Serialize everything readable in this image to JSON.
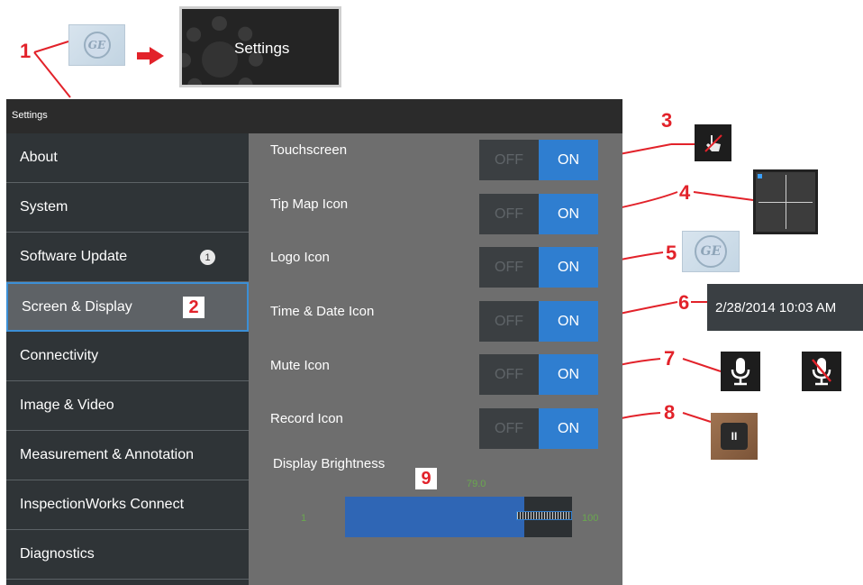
{
  "callouts": {
    "c1": "1",
    "c2": "2",
    "c3": "3",
    "c4": "4",
    "c5": "5",
    "c6": "6",
    "c7": "7",
    "c8": "8",
    "c9": "9"
  },
  "banner": {
    "label": "Settings",
    "logo_text": "GE"
  },
  "window": {
    "title": "Settings"
  },
  "sidebar": {
    "items": [
      {
        "label": "About"
      },
      {
        "label": "System"
      },
      {
        "label": "Software Update",
        "badge": "1"
      },
      {
        "label": "Screen & Display"
      },
      {
        "label": "Connectivity"
      },
      {
        "label": "Image & Video"
      },
      {
        "label": "Measurement & Annotation"
      },
      {
        "label": "InspectionWorks Connect"
      },
      {
        "label": "Diagnostics"
      }
    ],
    "selected": "Screen & Display"
  },
  "settings": [
    {
      "label": "Touchscreen",
      "off": "OFF",
      "on": "ON",
      "state": "ON"
    },
    {
      "label": "Tip Map Icon",
      "off": "OFF",
      "on": "ON",
      "state": "ON"
    },
    {
      "label": "Logo Icon",
      "off": "OFF",
      "on": "ON",
      "state": "ON"
    },
    {
      "label": "Time & Date Icon",
      "off": "OFF",
      "on": "ON",
      "state": "ON"
    },
    {
      "label": "Mute Icon",
      "off": "OFF",
      "on": "ON",
      "state": "ON"
    },
    {
      "label": "Record Icon",
      "off": "OFF",
      "on": "ON",
      "state": "ON"
    }
  ],
  "brightness": {
    "title": "Display Brightness",
    "value": "79.0",
    "value_num": 79,
    "min": "1",
    "max": "100"
  },
  "icons": {
    "logo_text": "GE",
    "datetime": "2/28/2014  10:03 AM",
    "record_symbol": "II"
  },
  "colors": {
    "callout": "#e2222a",
    "accent": "#2f7ed0",
    "sidebar": "#2f3437",
    "panel": "#6e6e6e"
  }
}
